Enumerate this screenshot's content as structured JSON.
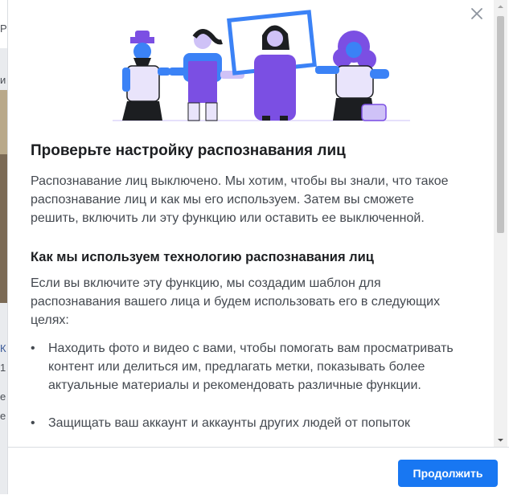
{
  "dialog": {
    "title": "Проверьте настройку распознавания лиц",
    "intro": "Распознавание лиц выключено. Мы хотим, чтобы вы знали, что такое распознавание лиц и как мы его используем. Затем вы сможете решить, включить ли эту функцию или оставить ее выключенной.",
    "section_title": "Как мы используем технологию распознавания лиц",
    "section_text": "Если вы включите эту функцию, мы создадим шаблон для распознавания вашего лица и будем использовать его в следующих целях:",
    "bullets": [
      "Находить фото и видео с вами, чтобы помогать вам просматривать контент или делиться им, предлагать метки, показывать более актуальные материалы и рекомендовать различные функции.",
      "Защищать ваш аккаунт и аккаунты других людей от попыток"
    ],
    "close_icon": "close-icon",
    "continue_label": "Продолжить"
  },
  "background": {
    "fragments": [
      "Р",
      "и",
      "К",
      "1",
      "е",
      "е"
    ]
  },
  "colors": {
    "primary": "#1877f2",
    "illustration_purple": "#7b4fe3",
    "illustration_blue": "#3b82f6",
    "illustration_light": "#cfc2f7"
  }
}
